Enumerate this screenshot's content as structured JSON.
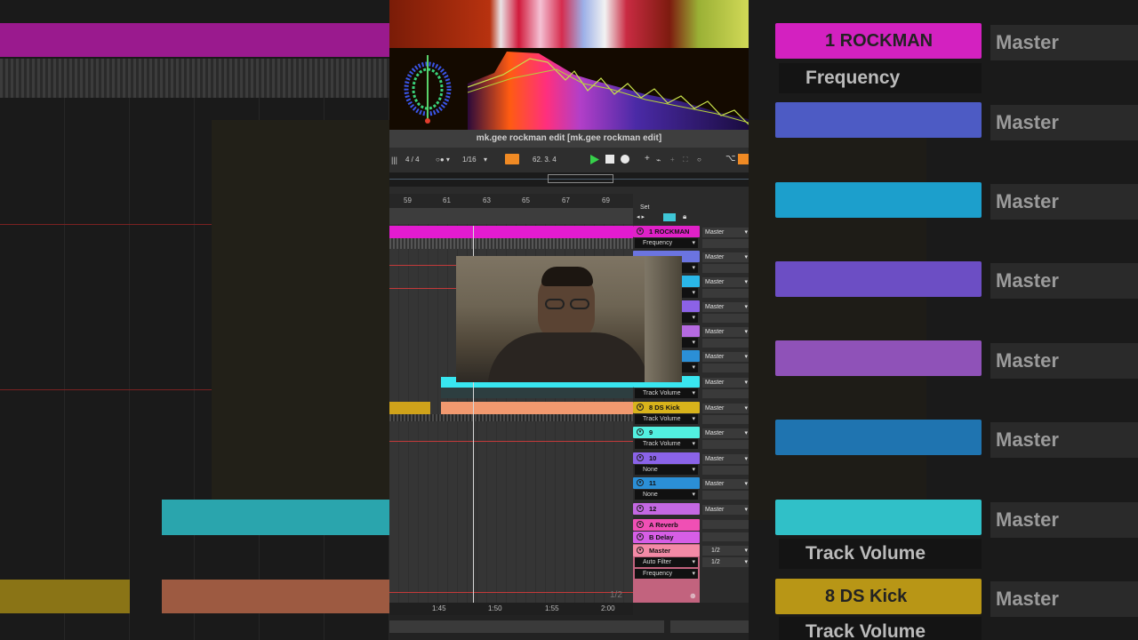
{
  "window": {
    "title": "mk.gee rockman edit  [mk.gee rockman edit]"
  },
  "transport": {
    "time_signature": "4 / 4",
    "quantize": "1/16",
    "position": "62.  3.  4"
  },
  "ruler": {
    "bars": [
      "59",
      "61",
      "63",
      "65",
      "67",
      "69"
    ]
  },
  "timeline": {
    "times": [
      "1:45",
      "1:50",
      "1:55",
      "2:00"
    ],
    "page": "1/2"
  },
  "set_label": "Set",
  "tracks": [
    {
      "name": "1 ROCKMAN",
      "color": "#e021c8",
      "device": "Frequency",
      "output": "Master"
    },
    {
      "name": "",
      "color": "#6b74e0",
      "device": "",
      "output": "Master"
    },
    {
      "name": "",
      "color": "#2ab7e8",
      "device": "",
      "output": "Master"
    },
    {
      "name": "",
      "color": "#8c62e6",
      "device": "",
      "output": "Master"
    },
    {
      "name": "",
      "color": "#b56ae0",
      "device": "",
      "output": "Master"
    },
    {
      "name": "",
      "color": "#2b8fd6",
      "device": "",
      "output": "Master"
    },
    {
      "name": "",
      "color": "#39e6f0",
      "device": "Track Volume",
      "output": "Master"
    },
    {
      "name": "8 DS Kick",
      "color": "#d8b31b",
      "device": "Track Volume",
      "output": "Master"
    },
    {
      "name": "9",
      "color": "#52f0e0",
      "device": "Track Volume",
      "output": "Master"
    },
    {
      "name": "10",
      "color": "#8a63e8",
      "device": "None",
      "output": "Master"
    },
    {
      "name": "11",
      "color": "#2b8fd6",
      "device": "None",
      "output": "Master"
    },
    {
      "name": "12",
      "color": "#c468e2",
      "device": "",
      "output": "Master"
    }
  ],
  "returns": [
    {
      "name": "A Reverb",
      "color": "#f04fb4"
    },
    {
      "name": "B Delay",
      "color": "#d65ee6"
    }
  ],
  "master": {
    "name": "Master",
    "color": "#f38aa6",
    "devices": [
      "Auto Filter",
      "Frequency"
    ],
    "outputs": [
      "1/2",
      "1/2"
    ]
  },
  "background_right": {
    "track1": "1 ROCKMAN",
    "device1": "Frequency",
    "masters": [
      "Master",
      "Master",
      "Master",
      "Master",
      "Master",
      "Master",
      "Master",
      "Master"
    ],
    "device_vol": "Track Volume",
    "kick": "8 DS Kick",
    "vol2": "Track Volume"
  }
}
